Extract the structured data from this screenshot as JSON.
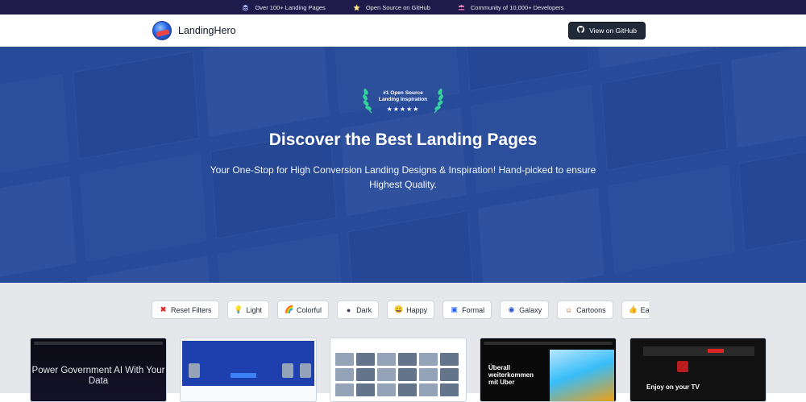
{
  "topbar": {
    "items": [
      {
        "icon": "stack-icon",
        "label": "Over 100+ Landing Pages"
      },
      {
        "icon": "star-icon",
        "label": "Open Source on GitHub"
      },
      {
        "icon": "people-icon",
        "label": "Community of 10,000+ Developers"
      }
    ]
  },
  "navbar": {
    "brand": "LandingHero",
    "github_button": "View on GitHub"
  },
  "hero": {
    "award_line1": "#1 Open Source",
    "award_line2": "Landing Inspiration",
    "stars": "★★★★★",
    "title": "Discover the Best Landing Pages",
    "subtitle": "Your One-Stop for High Conversion Landing Designs & Inspiration! Hand-picked to ensure Highest Quality."
  },
  "filters": [
    {
      "icon": "✖",
      "label": "Reset Filters",
      "color": "#dc2626"
    },
    {
      "icon": "💡",
      "label": "Light"
    },
    {
      "icon": "🌈",
      "label": "Colorful"
    },
    {
      "icon": "●",
      "label": "Dark"
    },
    {
      "icon": "😀",
      "label": "Happy"
    },
    {
      "icon": "▣",
      "label": "Formal"
    },
    {
      "icon": "◉",
      "label": "Galaxy"
    },
    {
      "icon": "☺",
      "label": "Cartoons"
    },
    {
      "icon": "👍",
      "label": "Easy"
    },
    {
      "icon": "▤",
      "label": ""
    }
  ],
  "cards": [
    {
      "title": "Power Government AI With Your Data"
    },
    {
      "title": ""
    },
    {
      "title": ""
    },
    {
      "title": "Überall weiterkommen mit Uber"
    },
    {
      "title": "Enjoy on your TV"
    }
  ],
  "colors": {
    "topbar": "#1e1b4b",
    "hero": "#2c50a0",
    "button": "#1f2937",
    "filters_bg": "#e5e7eb"
  }
}
